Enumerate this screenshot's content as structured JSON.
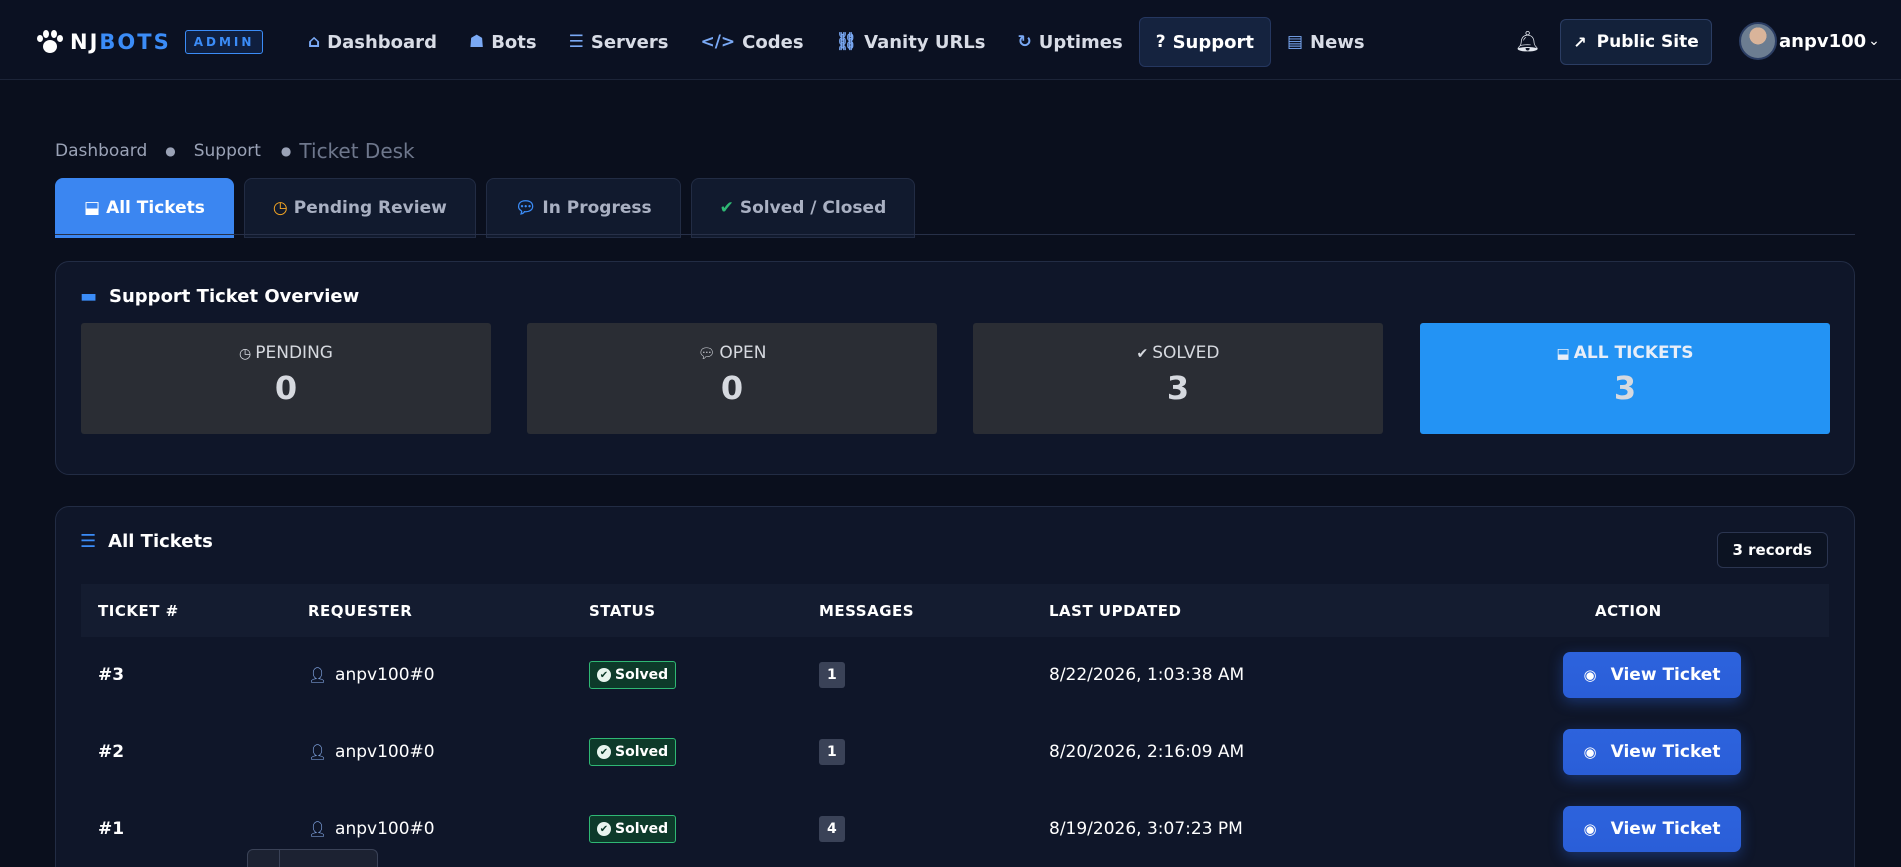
{
  "brand": {
    "prefix": "NJ",
    "suffix": "BOTS",
    "badge": "ADMIN"
  },
  "nav": [
    {
      "label": "Dashboard",
      "icon": "home-icon"
    },
    {
      "label": "Bots",
      "icon": "robot-icon"
    },
    {
      "label": "Servers",
      "icon": "server-icon"
    },
    {
      "label": "Codes",
      "icon": "code-icon"
    },
    {
      "label": "Vanity URLs",
      "icon": "link-icon"
    },
    {
      "label": "Uptimes",
      "icon": "sync-icon"
    },
    {
      "label": "Support",
      "icon": "question-circle-icon",
      "active": true
    },
    {
      "label": "News",
      "icon": "newspaper-icon"
    }
  ],
  "header": {
    "public_site": "Public Site",
    "username": "anpv100"
  },
  "breadcrumb": {
    "home": "Dashboard",
    "section": "Support",
    "current": "Ticket Desk"
  },
  "tabs": [
    {
      "label": "All Tickets",
      "icon": "inbox-icon",
      "color": "#ffffff"
    },
    {
      "label": "Pending Review",
      "icon": "clock-icon",
      "color": "#f5a623"
    },
    {
      "label": "In Progress",
      "icon": "comments-icon",
      "color": "#3b8cf7"
    },
    {
      "label": "Solved / Closed",
      "icon": "check-circle-icon",
      "color": "#2fb874"
    }
  ],
  "overview": {
    "title": "Support Ticket Overview",
    "stats": [
      {
        "label": "PENDING",
        "value": "0",
        "icon": "clock-icon"
      },
      {
        "label": "OPEN",
        "value": "0",
        "icon": "comments-icon"
      },
      {
        "label": "SOLVED",
        "value": "3",
        "icon": "check-circle-icon"
      },
      {
        "label": "ALL TICKETS",
        "value": "3",
        "icon": "inbox-icon"
      }
    ]
  },
  "tickets": {
    "title": "All Tickets",
    "records": "3 records",
    "columns": [
      "TICKET #",
      "REQUESTER",
      "STATUS",
      "MESSAGES",
      "LAST UPDATED",
      "ACTION"
    ],
    "rows": [
      {
        "id": "#3",
        "requester": "anpv100#0",
        "status": "Solved",
        "messages": "1",
        "updated": "8/22/2026, 1:03:38 AM",
        "action": "View Ticket"
      },
      {
        "id": "#2",
        "requester": "anpv100#0",
        "status": "Solved",
        "messages": "1",
        "updated": "8/20/2026, 2:16:09 AM",
        "action": "View Ticket"
      },
      {
        "id": "#1",
        "requester": "anpv100#0",
        "status": "Solved",
        "messages": "4",
        "updated": "8/19/2026, 3:07:23 PM",
        "action": "View Ticket"
      }
    ]
  },
  "colors": {
    "accent": "#3b86f1",
    "all_tickets_stat": "#2393f4",
    "solved": "#2fb874",
    "background": "#0a0f1d"
  }
}
